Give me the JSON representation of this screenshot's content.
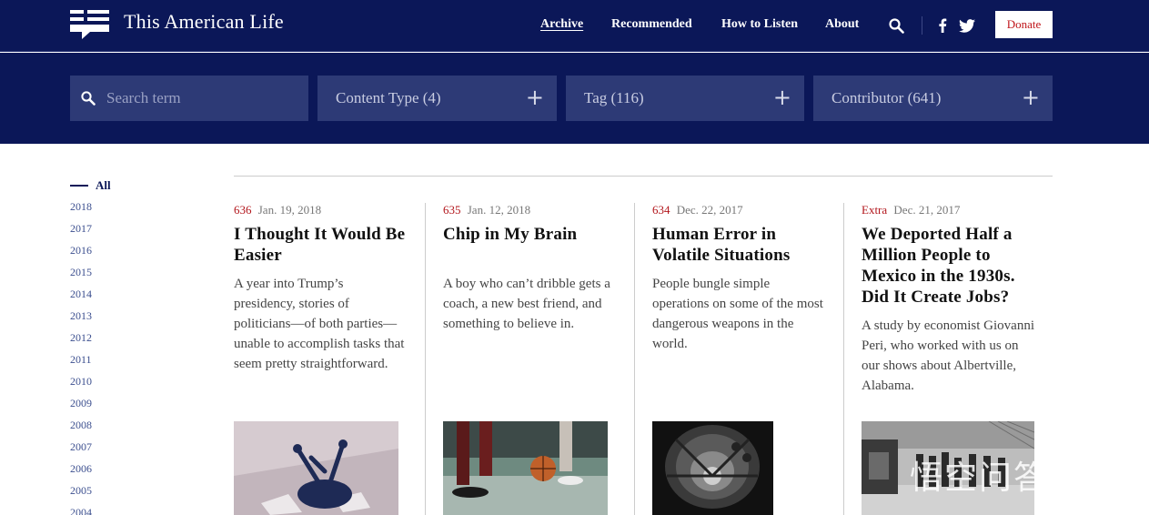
{
  "header": {
    "site_title": "This American Life",
    "nav": [
      {
        "label": "Archive",
        "active": true
      },
      {
        "label": "Recommended",
        "active": false
      },
      {
        "label": "How to Listen",
        "active": false
      },
      {
        "label": "About",
        "active": false
      }
    ],
    "donate_label": "Donate",
    "icons": [
      "search-icon",
      "facebook-icon",
      "twitter-icon"
    ]
  },
  "filters": {
    "search_placeholder": "Search term",
    "content_type": "Content Type (4)",
    "tag": "Tag (116)",
    "contributor": "Contributor (641)"
  },
  "years": {
    "all_label": "All",
    "list": [
      "2018",
      "2017",
      "2016",
      "2015",
      "2014",
      "2013",
      "2012",
      "2011",
      "2010",
      "2009",
      "2008",
      "2007",
      "2006",
      "2005",
      "2004"
    ]
  },
  "episodes": [
    {
      "number": "636",
      "date": "Jan. 19, 2018",
      "title": "I Thought It Would Be Easier",
      "description": "A year into Trump’s presidency, stories of politicians—of both parties—unable to accomplish tasks that seem pretty straightforward."
    },
    {
      "number": "635",
      "date": "Jan. 12, 2018",
      "title": "Chip in My Brain",
      "description": "A boy who can’t dribble gets a coach, a new best friend, and something to believe in."
    },
    {
      "number": "634",
      "date": "Dec. 22, 2017",
      "title": "Human Error in Volatile Situations",
      "description": "People bungle simple operations on some of the most dangerous weapons in the world."
    },
    {
      "number": "Extra",
      "date": "Dec. 21, 2017",
      "title": "We Deported Half a Million People to Mexico in the 1930s. Did It Create Jobs?",
      "description": "A study by economist Giovanni Peri, who worked with us on our shows about Albertville, Alabama."
    }
  ],
  "watermark": "悟空问答",
  "colors": {
    "navy": "#0b1758",
    "filter_bg": "#2d3a76",
    "episode_red": "#b2151b",
    "year_link": "#3c4f8f"
  }
}
